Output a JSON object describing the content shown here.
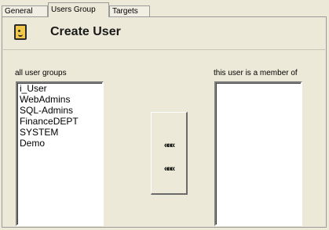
{
  "tabs": [
    {
      "label": "General",
      "active": false
    },
    {
      "label": "Users Group",
      "active": true
    },
    {
      "label": "Targets",
      "active": false
    }
  ],
  "header": {
    "icon": "user-card-icon",
    "title": "Create User"
  },
  "all_groups": {
    "label": "all user groups",
    "items": [
      "i_User",
      "WebAdmins",
      "SQL-Admins",
      "FinanceDEPT",
      "SYSTEM",
      "Demo"
    ]
  },
  "member_of": {
    "label": "this user is a member of",
    "items": []
  },
  "move_buttons": [
    {
      "label": "«««",
      "icon": "move-left-icon"
    },
    {
      "label": "«««",
      "icon": "move-left-icon"
    }
  ],
  "colors": {
    "background": "#ece9d8",
    "list_background": "#ffffff",
    "icon_fill": "#f2c84b"
  }
}
